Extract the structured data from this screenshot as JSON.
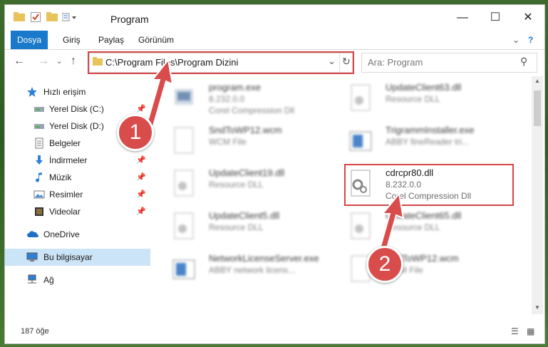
{
  "window": {
    "title": "Program"
  },
  "ribbon": {
    "tabs": [
      "Dosya",
      "Giriş",
      "Paylaş",
      "Görünüm"
    ]
  },
  "address": {
    "path": "C:\\Program Files\\Program Dizini"
  },
  "search": {
    "placeholder": "Ara: Program"
  },
  "sidebar": {
    "items": [
      {
        "label": "Hızlı erişim",
        "icon": "star-icon"
      },
      {
        "label": "Yerel Disk (C:)",
        "icon": "drive-icon"
      },
      {
        "label": "Yerel Disk (D:)",
        "icon": "drive-icon"
      },
      {
        "label": "Belgeler",
        "icon": "documents-icon"
      },
      {
        "label": "İndirmeler",
        "icon": "download-icon"
      },
      {
        "label": "Müzik",
        "icon": "music-icon"
      },
      {
        "label": "Resimler",
        "icon": "pictures-icon"
      },
      {
        "label": "Videolar",
        "icon": "video-icon"
      },
      {
        "label": "OneDrive",
        "icon": "cloud-icon"
      },
      {
        "label": "Bu bilgisayar",
        "icon": "computer-icon"
      },
      {
        "label": "Ağ",
        "icon": "network-icon"
      }
    ]
  },
  "files": [
    {
      "name": "program.exe",
      "sub1": "8.232.0.0",
      "sub2": "Corel Compression Dll"
    },
    {
      "name": "UpdateClient63.dll",
      "sub1": "Resource DLL",
      "sub2": ""
    },
    {
      "name": "SndToWP12.wcm",
      "sub1": "WCM File",
      "sub2": ""
    },
    {
      "name": "TrigrammInstaller.exe",
      "sub1": "ABBY fineReader tri...",
      "sub2": ""
    },
    {
      "name": "UpdateClient19.dll",
      "sub1": "Resource DLL",
      "sub2": ""
    },
    {
      "name": "cdrcpr80.dll",
      "sub1": "8.232.0.0",
      "sub2": "Corel Compression Dll"
    },
    {
      "name": "UpdateClient5.dll",
      "sub1": "Resource DLL",
      "sub2": ""
    },
    {
      "name": "UpdateClient65.dll",
      "sub1": "Resource DLL",
      "sub2": ""
    },
    {
      "name": "NetworkLicenseServer.exe",
      "sub1": "ABBY network licens...",
      "sub2": ""
    },
    {
      "name": "SndToWP12.wcm",
      "sub1": "WCM File",
      "sub2": ""
    }
  ],
  "status": {
    "count": "187 öğe"
  },
  "annotations": {
    "badge1": "1",
    "badge2": "2"
  },
  "colors": {
    "accent": "#1979ca",
    "highlight": "#d64545",
    "selected": "#cce4f7"
  }
}
